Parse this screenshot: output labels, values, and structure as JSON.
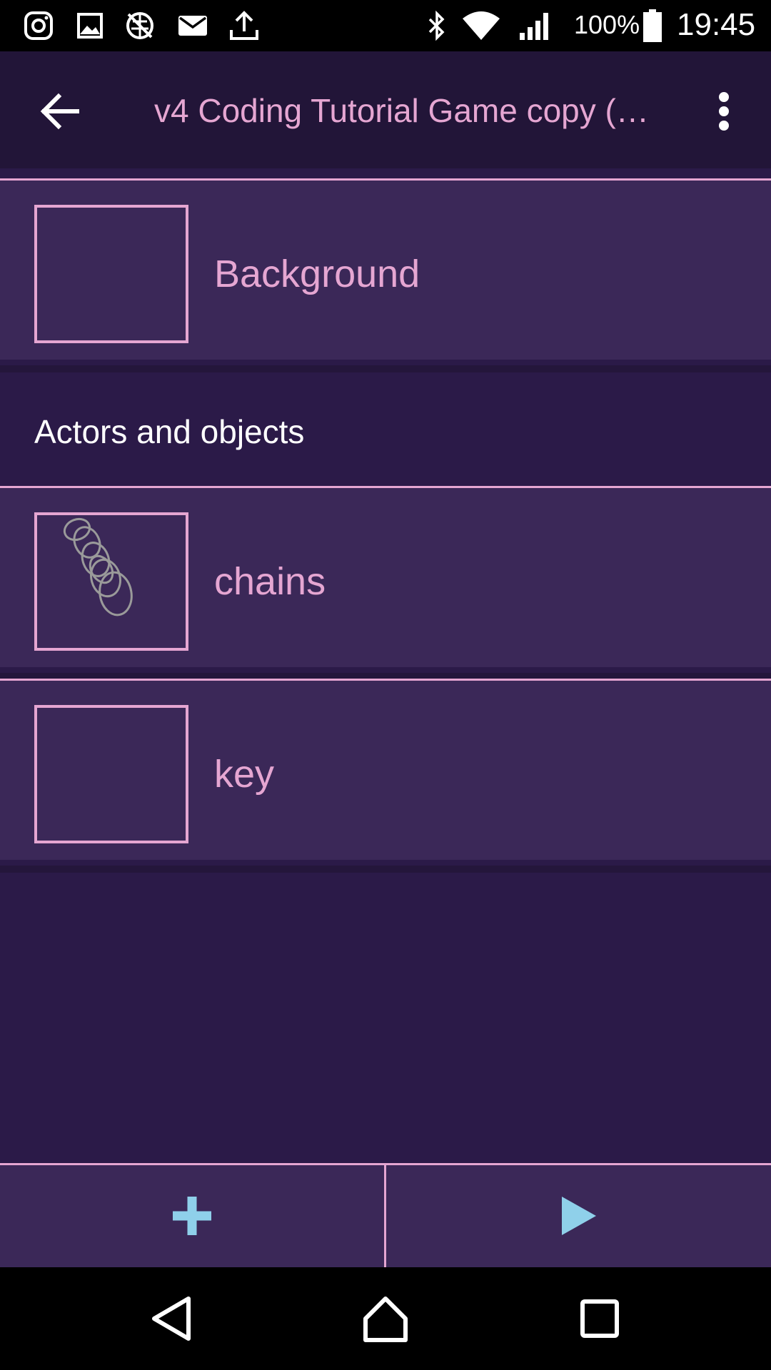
{
  "status_bar": {
    "battery_text": "100%",
    "time": "19:45",
    "icons": [
      "instagram-icon",
      "image-icon",
      "no-sync-icon",
      "mail-icon",
      "upload-icon",
      "bluetooth-icon",
      "wifi-icon",
      "signal-icon",
      "battery-icon"
    ]
  },
  "app_bar": {
    "title": "v4 Coding Tutorial Game copy (…",
    "back_icon": "arrow-left-icon",
    "menu_icon": "more-vert-icon"
  },
  "background_item": {
    "label": "Background"
  },
  "actors_section": {
    "header": "Actors and objects",
    "items": [
      {
        "label": "chains",
        "thumbnail": "chains-sprite"
      },
      {
        "label": "key",
        "thumbnail": ""
      }
    ]
  },
  "bottom_bar": {
    "add_icon": "plus-icon",
    "play_icon": "play-icon"
  },
  "colors": {
    "accent": "#e5a6d2",
    "action_icon": "#8fd0ea",
    "background": "#2b1a48",
    "row": "#3b2858",
    "app_bar": "#221538"
  },
  "nav_bar": {
    "icons": [
      "back-triangle-icon",
      "home-icon",
      "recents-icon"
    ]
  }
}
